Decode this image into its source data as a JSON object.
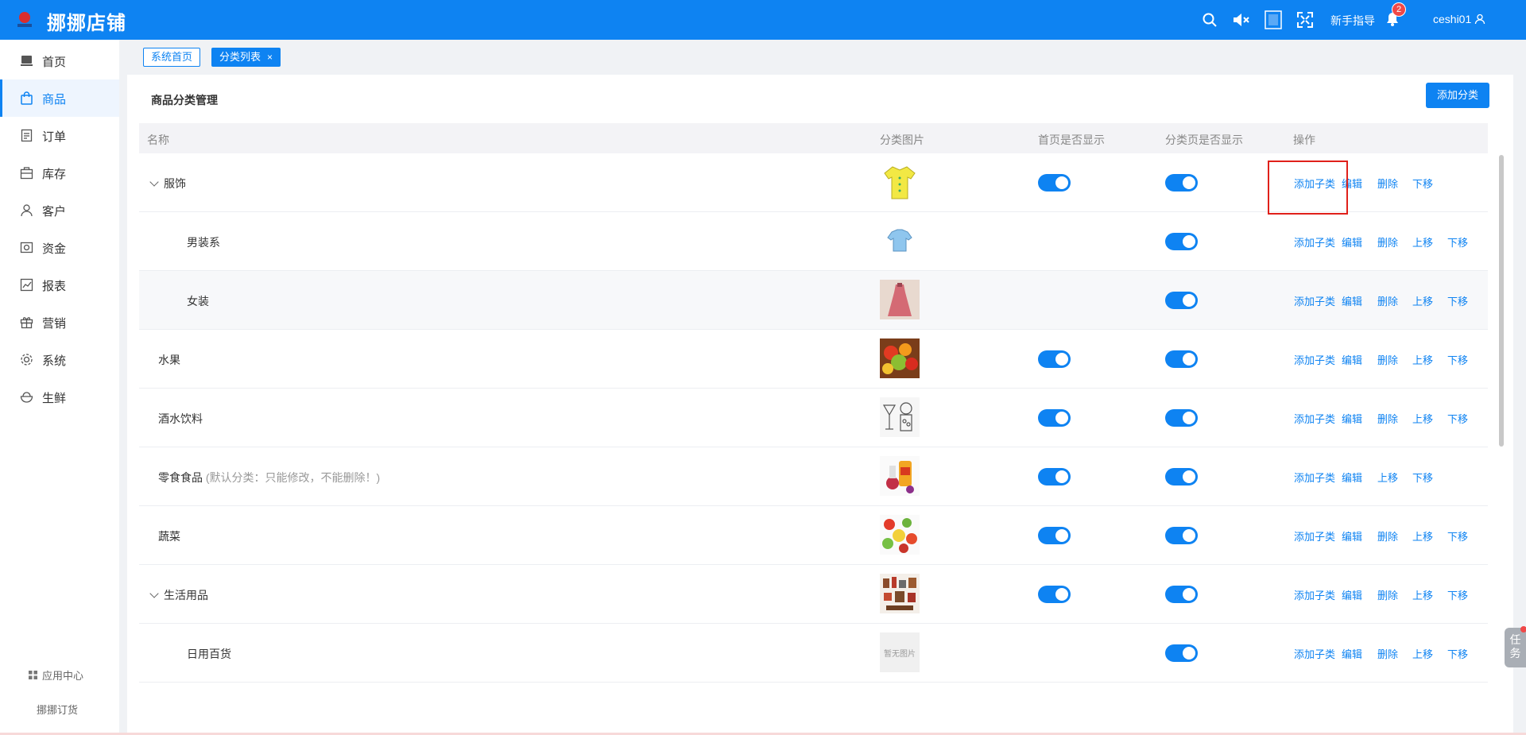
{
  "header": {
    "app_name": "挪挪店铺",
    "guide_label": "新手指导",
    "notification_count": "2",
    "username": "ceshi01",
    "brand_color": "#0e83f2"
  },
  "sidebar": {
    "items": [
      {
        "label": "首页",
        "icon": "home-icon"
      },
      {
        "label": "商品",
        "icon": "bag-icon",
        "active": true
      },
      {
        "label": "订单",
        "icon": "document-icon"
      },
      {
        "label": "库存",
        "icon": "warehouse-icon"
      },
      {
        "label": "客户",
        "icon": "user-icon"
      },
      {
        "label": "资金",
        "icon": "wallet-icon"
      },
      {
        "label": "报表",
        "icon": "chart-icon"
      },
      {
        "label": "营销",
        "icon": "gift-icon"
      },
      {
        "label": "系统",
        "icon": "gear-icon"
      },
      {
        "label": "生鲜",
        "icon": "bowl-icon"
      }
    ],
    "app_center": "应用中心",
    "order_app": "挪挪订货"
  },
  "tags": {
    "home": "系统首页",
    "active": "分类列表",
    "close": "×"
  },
  "page": {
    "title": "商品分类管理",
    "add_button": "添加分类"
  },
  "table": {
    "columns": {
      "name": "名称",
      "image": "分类图片",
      "home_show": "首页是否显示",
      "cat_show": "分类页是否显示",
      "ops": "操作"
    },
    "actions": {
      "add_child": "添加子类",
      "edit": "编辑",
      "delete": "删除",
      "up": "上移",
      "down": "下移"
    },
    "no_image": "暂无图片",
    "rows": [
      {
        "name": "服饰",
        "level": 0,
        "expandable": true,
        "image": "shirt-yellow",
        "home_show": true,
        "cat_show": true,
        "actions": [
          "add_child",
          "edit",
          "delete",
          "down"
        ]
      },
      {
        "name": "男装系",
        "level": 1,
        "image": "shirt-blue",
        "home_show": null,
        "cat_show": true,
        "actions": [
          "add_child",
          "edit",
          "delete",
          "up",
          "down"
        ]
      },
      {
        "name": "女装",
        "level": 1,
        "image": "dress-pink",
        "home_show": null,
        "cat_show": true,
        "actions": [
          "add_child",
          "edit",
          "delete",
          "up",
          "down"
        ]
      },
      {
        "name": "水果",
        "level": 0,
        "image": "fruit-basket",
        "home_show": true,
        "cat_show": true,
        "actions": [
          "add_child",
          "edit",
          "delete",
          "up",
          "down"
        ]
      },
      {
        "name": "酒水饮料",
        "level": 0,
        "image": "drinks-sketch",
        "home_show": true,
        "cat_show": true,
        "actions": [
          "add_child",
          "edit",
          "delete",
          "up",
          "down"
        ]
      },
      {
        "name": "零食食品",
        "note": "(默认分类：只能修改，不能删除！)",
        "level": 0,
        "image": "snacks",
        "home_show": true,
        "cat_show": true,
        "actions": [
          "add_child",
          "edit",
          "up",
          "down"
        ]
      },
      {
        "name": "蔬菜",
        "level": 0,
        "image": "vegetables",
        "home_show": true,
        "cat_show": true,
        "actions": [
          "add_child",
          "edit",
          "delete",
          "up",
          "down"
        ]
      },
      {
        "name": "生活用品",
        "level": 0,
        "expandable": true,
        "image": "household",
        "home_show": true,
        "cat_show": true,
        "actions": [
          "add_child",
          "edit",
          "delete",
          "up",
          "down"
        ]
      },
      {
        "name": "日用百货",
        "level": 1,
        "image": null,
        "home_show": null,
        "cat_show": true,
        "actions": [
          "add_child",
          "edit",
          "delete",
          "up",
          "down"
        ]
      }
    ]
  },
  "task_widget": "任务"
}
